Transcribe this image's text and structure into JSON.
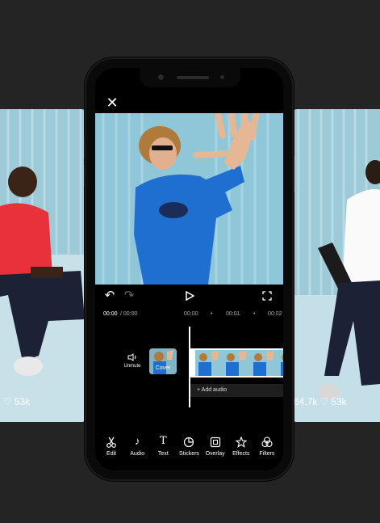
{
  "left_card": {
    "likes": "53k"
  },
  "right_card": {
    "likes_a": "64.7k",
    "likes_b": "53k"
  },
  "editor": {
    "time_current": "00:00",
    "time_total": "/ 00:00",
    "ruler": [
      "00:00",
      "00:01",
      "00:02"
    ],
    "unmute_label": "Unmute",
    "cover_label": "Cover",
    "add_audio_label": "+ Add audio",
    "toolbar": [
      {
        "label": "Edit",
        "icon": "scissors-icon"
      },
      {
        "label": "Audio",
        "icon": "music-note-icon"
      },
      {
        "label": "Text",
        "icon": "text-icon"
      },
      {
        "label": "Stickers",
        "icon": "sticker-icon"
      },
      {
        "label": "Overlay",
        "icon": "overlay-icon"
      },
      {
        "label": "Effects",
        "icon": "effects-icon"
      },
      {
        "label": "Filters",
        "icon": "filters-icon"
      }
    ]
  },
  "colors": {
    "background": "#242424",
    "shirt_blue": "#1f6fd1",
    "shirt_red": "#e8313a",
    "sky": "#8fc6d8"
  }
}
